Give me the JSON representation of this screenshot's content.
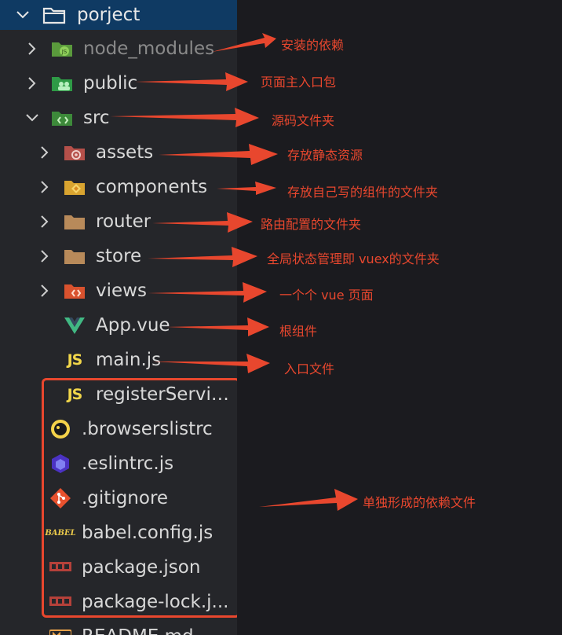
{
  "explorer": {
    "root": {
      "name": "porject"
    },
    "items": [
      {
        "name": "node_modules",
        "chevron": "right",
        "icon": "node-folder-icon"
      },
      {
        "name": "public",
        "chevron": "right",
        "icon": "public-folder-icon"
      },
      {
        "name": "src",
        "chevron": "down",
        "icon": "src-folder-icon"
      },
      {
        "name": "assets",
        "chevron": "right",
        "icon": "assets-folder-icon"
      },
      {
        "name": "components",
        "chevron": "right",
        "icon": "components-folder-icon"
      },
      {
        "name": "router",
        "chevron": "right",
        "icon": "folder-icon"
      },
      {
        "name": "store",
        "chevron": "right",
        "icon": "folder-icon"
      },
      {
        "name": "views",
        "chevron": "right",
        "icon": "views-folder-icon"
      },
      {
        "name": "App.vue",
        "icon": "vue-icon"
      },
      {
        "name": "main.js",
        "icon": "js-icon",
        "glyph": "JS"
      },
      {
        "name": "registerServic...",
        "icon": "js-icon",
        "glyph": "JS"
      },
      {
        "name": ".browserslistrc",
        "icon": "browserslist-icon"
      },
      {
        "name": ".eslintrc.js",
        "icon": "eslint-icon"
      },
      {
        "name": ".gitignore",
        "icon": "git-icon"
      },
      {
        "name": "babel.config.js",
        "icon": "babel-icon",
        "glyph": "BABEL"
      },
      {
        "name": "package.json",
        "icon": "npm-icon"
      },
      {
        "name": "package-lock.j...",
        "icon": "npm-icon"
      },
      {
        "name": "README.md",
        "icon": "markdown-icon"
      }
    ]
  },
  "annotations": [
    {
      "text": "安装的依赖"
    },
    {
      "text": "页面主入口包"
    },
    {
      "text": "源码文件夹"
    },
    {
      "text": "存放静态资源"
    },
    {
      "text": "存放自己写的组件的文件夹"
    },
    {
      "text": "路由配置的文件夹"
    },
    {
      "text": "全局状态管理即 vuex的文件夹"
    },
    {
      "text": "一个个 vue 页面"
    },
    {
      "text": "根组件"
    },
    {
      "text": "入口文件"
    },
    {
      "text": "单独形成的依赖文件"
    }
  ],
  "colors": {
    "annotation": "#e8472e",
    "root_highlight": "#0f3a63",
    "panel": "#25262a"
  }
}
